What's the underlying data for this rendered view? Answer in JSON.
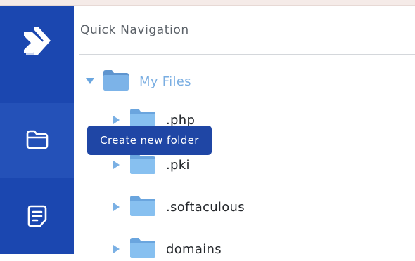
{
  "sidebar": {
    "logo_icon": "chevron-right-logo-icon",
    "items": [
      {
        "name": "file-manager",
        "icon": "folder-outline-icon",
        "active": true
      },
      {
        "name": "documents",
        "icon": "document-icon",
        "active": false
      }
    ],
    "colors": {
      "background": "#1b47b0",
      "active": "#2451b8"
    }
  },
  "header": {
    "title": "Quick Navigation"
  },
  "tree": {
    "root": {
      "label": "My Files",
      "expanded": true,
      "color": "#7aaee2"
    },
    "children": [
      {
        "label": ".php"
      },
      {
        "label": ".pki"
      },
      {
        "label": ".softaculous"
      },
      {
        "label": "domains"
      }
    ]
  },
  "tooltip": {
    "text": "Create new folder"
  }
}
